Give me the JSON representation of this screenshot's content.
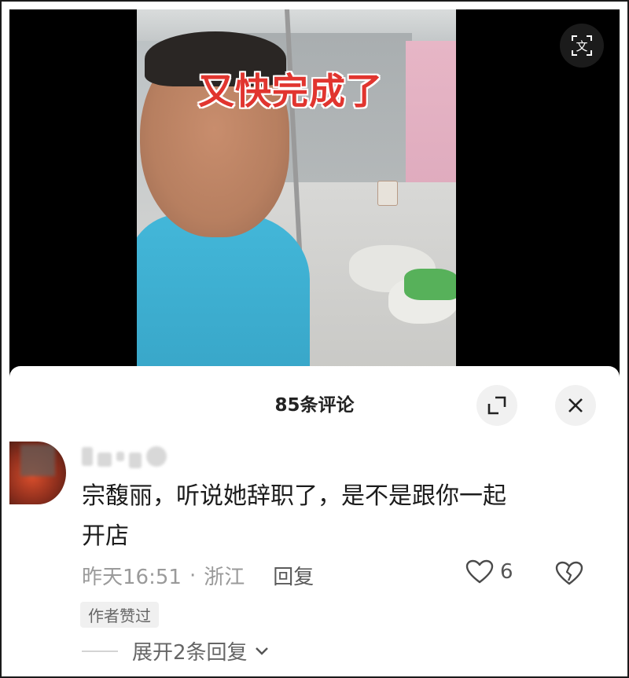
{
  "video": {
    "caption": "又快完成了",
    "translate_label": "文"
  },
  "comments_panel": {
    "title": "85条评论",
    "comment": {
      "text_line1": "宗馥丽，听说她辞职了，是不是跟你一起",
      "text_line2": "开店",
      "time": "昨天16:51",
      "separator": "·",
      "location": "浙江",
      "reply_label": "回复",
      "like_count": "6",
      "author_liked_badge": "作者赞过",
      "expand_replies_label": "展开2条回复"
    }
  },
  "icons": {
    "translate": "translate-icon",
    "expand": "expand-icon",
    "close": "close-icon",
    "heart": "heart-icon",
    "broken_heart": "broken-heart-icon",
    "chevron": "chevron-down-icon"
  },
  "colors": {
    "caption_red": "#e1352f",
    "text_primary": "#1c1c1c",
    "text_muted": "#9a9a9a"
  }
}
